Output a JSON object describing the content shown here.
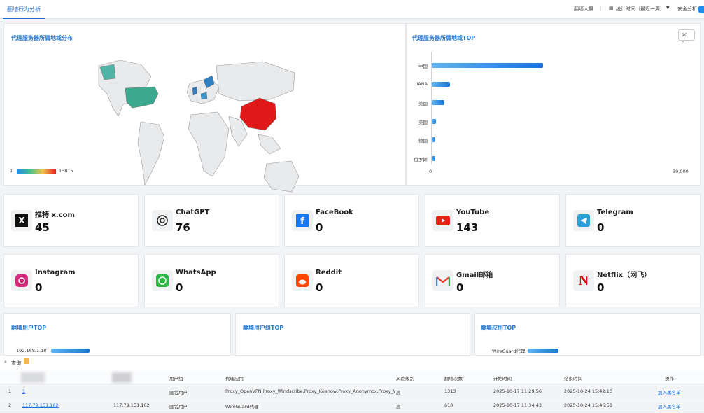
{
  "topbar": {
    "tab": "翻墙行为分析",
    "screen_link": "翻墙大屏",
    "stat_time": "统计时间（最近一周）",
    "security": "安全分析"
  },
  "map_card": {
    "title": "代理服务器所属地域分布",
    "legend_min": "1",
    "legend_max": "13815"
  },
  "top_card": {
    "title": "代理服务器所属地域TOP",
    "select_value": "10",
    "countries": [
      "中国",
      "IANA",
      "美国",
      "英国",
      "德国",
      "俄罗斯"
    ],
    "values": [
      13815,
      2300,
      1600,
      550,
      450,
      420
    ],
    "axis_min": "0",
    "axis_max": "30,000",
    "xmax": 30000
  },
  "apps": [
    {
      "name": "推特 x.com",
      "value": "45",
      "icon": "x-icon"
    },
    {
      "name": "ChatGPT",
      "value": "76",
      "icon": "chatgpt-icon"
    },
    {
      "name": "FaceBook",
      "value": "0",
      "icon": "facebook-icon"
    },
    {
      "name": "YouTube",
      "value": "143",
      "icon": "youtube-icon"
    },
    {
      "name": "Telegram",
      "value": "0",
      "icon": "telegram-icon"
    },
    {
      "name": "Instagram",
      "value": "0",
      "icon": "instagram-icon"
    },
    {
      "name": "WhatsApp",
      "value": "0",
      "icon": "whatsapp-icon"
    },
    {
      "name": "Reddit",
      "value": "0",
      "icon": "reddit-icon"
    },
    {
      "name": "Gmail邮箱",
      "value": "0",
      "icon": "gmail-icon"
    },
    {
      "name": "Netflix（网飞）",
      "value": "0",
      "icon": "netflix-icon"
    }
  ],
  "bottom_cards": {
    "users_title": "翻墙用户TOP",
    "user_label": "192.168.1.18",
    "groups_title": "翻墙用户组TOP",
    "apps_title": "翻墙应用TOP",
    "app_label": "WireGuard代理"
  },
  "query": {
    "label": "查询"
  },
  "table": {
    "headers": [
      "用户组",
      "代理应用",
      "风险级别",
      "翻墙次数",
      "开始时间",
      "结束时间",
      "操作"
    ],
    "rows": [
      {
        "idx": "1",
        "user": "1",
        "ip": "",
        "group": "匿名用户",
        "app": "Proxy_OpenVPN,Proxy_Windscribe,Proxy_Keenow,Proxy_Anonymox,Proxy_Wayscr",
        "risk": "高",
        "count": "1313",
        "start": "2025-10-17 11:29:56",
        "end": "2025-10-24 15:42:10",
        "action": "加入黑名单"
      },
      {
        "idx": "2",
        "user": "117.79.151.162",
        "ip": "117.79.151.162",
        "group": "匿名用户",
        "app": "WireGuard代理",
        "risk": "高",
        "count": "610",
        "start": "2025-10-17 11:34:43",
        "end": "2025-10-24 15:46:58",
        "action": "加入黑名单"
      }
    ]
  }
}
